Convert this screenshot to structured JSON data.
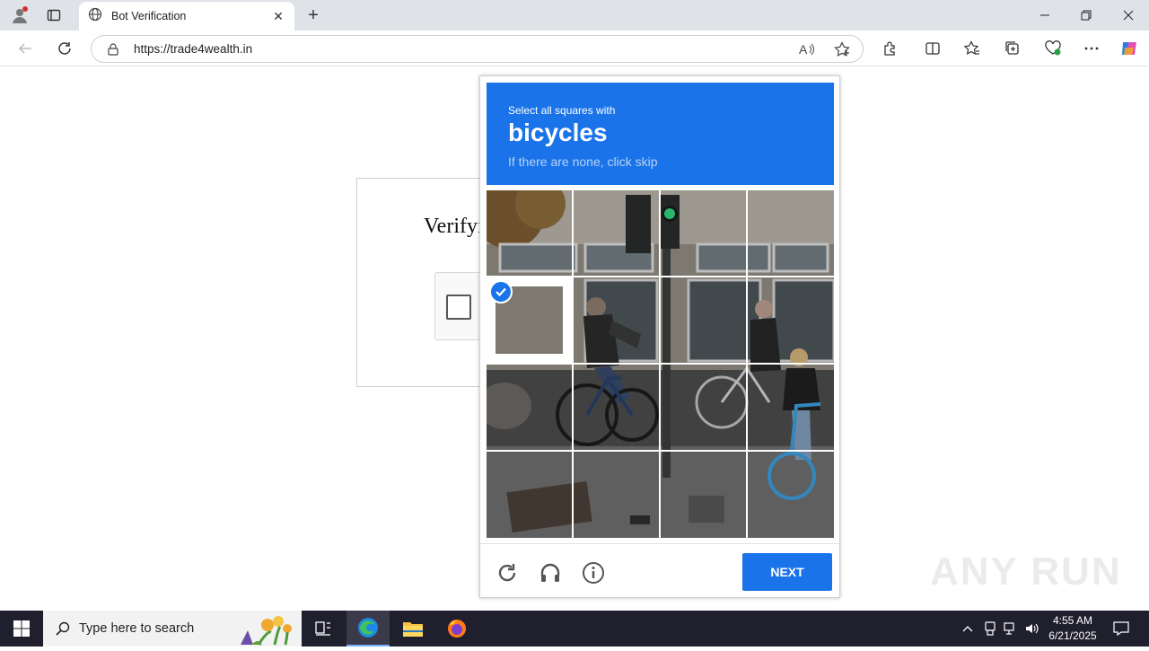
{
  "browser": {
    "tab_title": "Bot Verification",
    "url": "https://trade4wealth.in"
  },
  "page": {
    "verify_heading": "Verifyi"
  },
  "captcha": {
    "prompt_pre": "Select all squares with",
    "target": "bicycles",
    "prompt_sub": "If there are none, click skip",
    "next_label": "NEXT",
    "selected_tiles": [
      4
    ]
  },
  "watermark": "ANY RUN",
  "taskbar": {
    "search_placeholder": "Type here to search",
    "time": "4:55 AM",
    "date": "6/21/2025"
  },
  "colors": {
    "accent": "#1a73e8"
  }
}
